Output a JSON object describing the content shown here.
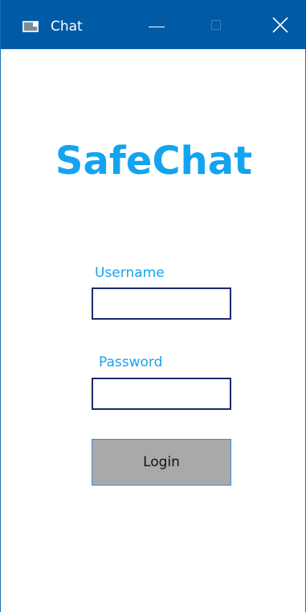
{
  "window": {
    "title": "Chat",
    "controls": {
      "minimize": "minimize-button",
      "maximize": "maximize-button",
      "close": "close-button"
    }
  },
  "logo": {
    "text": "SafeChat"
  },
  "form": {
    "username_label": "Username",
    "username_value": "",
    "password_label": "Password",
    "password_value": "",
    "login_label": "Login"
  },
  "colors": {
    "titlebar": "#005aa6",
    "accent": "#13a4f0",
    "label": "#1aa3ec",
    "input_border": "#1c2a6b",
    "button_bg": "#a9a9a9",
    "button_border": "#3c8ce0"
  },
  "icons": [
    "app-window-icon",
    "minimize-icon",
    "maximize-icon",
    "close-icon"
  ]
}
